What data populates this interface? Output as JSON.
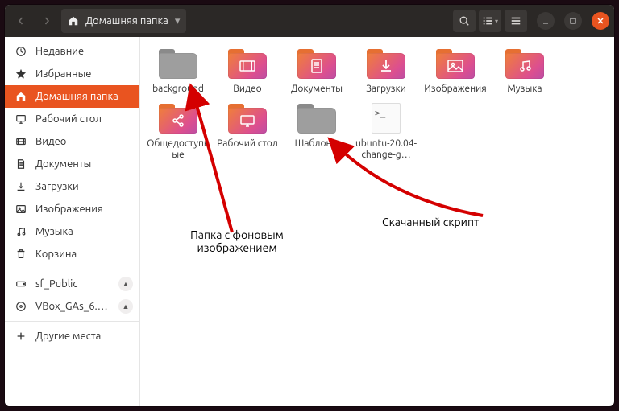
{
  "titlebar": {
    "path_label": "Домашняя папка"
  },
  "sidebar": {
    "items": [
      {
        "label": "Недавние",
        "active": false,
        "icon": "clock"
      },
      {
        "label": "Избранные",
        "active": false,
        "icon": "star"
      },
      {
        "label": "Домашняя папка",
        "active": true,
        "icon": "home"
      },
      {
        "label": "Рабочий стол",
        "active": false,
        "icon": "desktop"
      },
      {
        "label": "Видео",
        "active": false,
        "icon": "video"
      },
      {
        "label": "Документы",
        "active": false,
        "icon": "document"
      },
      {
        "label": "Загрузки",
        "active": false,
        "icon": "download"
      },
      {
        "label": "Изображения",
        "active": false,
        "icon": "image"
      },
      {
        "label": "Музыка",
        "active": false,
        "icon": "music"
      },
      {
        "label": "Корзина",
        "active": false,
        "icon": "trash"
      },
      {
        "label": "sf_Public",
        "active": false,
        "icon": "drive",
        "eject": true
      },
      {
        "label": "VBox_GAs_6.…",
        "active": false,
        "icon": "disc",
        "eject": true
      },
      {
        "label": "Другие места",
        "active": false,
        "icon": "plus"
      }
    ]
  },
  "items": [
    {
      "label": "background",
      "type": "folder-grey",
      "glyph": ""
    },
    {
      "label": "Видео",
      "type": "folder",
      "glyph": "video"
    },
    {
      "label": "Документы",
      "type": "folder",
      "glyph": "document"
    },
    {
      "label": "Загрузки",
      "type": "folder",
      "glyph": "download"
    },
    {
      "label": "Изображения",
      "type": "folder",
      "glyph": "image"
    },
    {
      "label": "Музыка",
      "type": "folder",
      "glyph": "music"
    },
    {
      "label": "Общедоступные",
      "type": "folder",
      "glyph": "share"
    },
    {
      "label": "Рабочий стол",
      "type": "folder",
      "glyph": "desktop"
    },
    {
      "label": "Шаблоны",
      "type": "folder-grey",
      "glyph": ""
    },
    {
      "label": "ubuntu-20.04-change-g…",
      "type": "file",
      "glyph": ">_"
    }
  ],
  "annotations": {
    "left": "Папка с фоновым изображением",
    "right": "Скачанный скрипт"
  }
}
